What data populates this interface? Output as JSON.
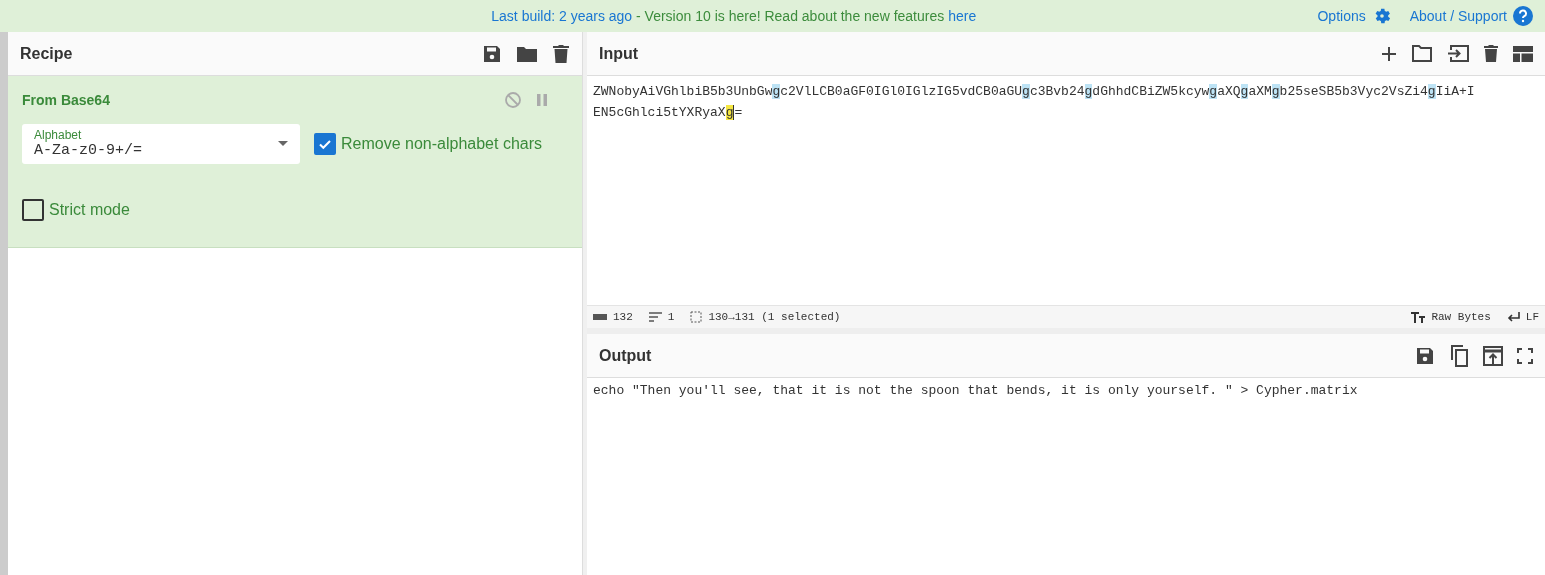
{
  "banner": {
    "segments": [
      {
        "text": "Last build: 2 years ago",
        "link": true
      },
      {
        "text": " - Version 10 is here! Read about the new features ",
        "link": false
      },
      {
        "text": "here",
        "link": true
      }
    ],
    "links": [
      {
        "label": "Options"
      },
      {
        "label": "About / Support"
      }
    ]
  },
  "recipe": {
    "title": "Recipe",
    "operations": [
      {
        "name": "From Base64",
        "alphabet": {
          "label": "Alphabet",
          "value": "A-Za-z0-9+/="
        },
        "options": [
          {
            "label": "Remove non-alphabet chars",
            "checked": true
          },
          {
            "label": "Strict mode",
            "checked": false
          }
        ]
      }
    ]
  },
  "input": {
    "title": "Input",
    "lines": [
      [
        {
          "text": "ZWNobyAiVGhlbiB5b3UnbGw",
          "match": false,
          "selected": false
        },
        {
          "text": "g",
          "match": true,
          "selected": false
        },
        {
          "text": "c2VlLCB0aGF0IGl0IGlzIG5vdCB0aGU",
          "match": false,
          "selected": false
        },
        {
          "text": "g",
          "match": true,
          "selected": false
        },
        {
          "text": "c3Bvb24",
          "match": false,
          "selected": false
        },
        {
          "text": "g",
          "match": true,
          "selected": false
        },
        {
          "text": "dGhhdCBiZW5kcyw",
          "match": false,
          "selected": false
        },
        {
          "text": "g",
          "match": true,
          "selected": false
        },
        {
          "text": "aXQ",
          "match": false,
          "selected": false
        },
        {
          "text": "g",
          "match": true,
          "selected": false
        },
        {
          "text": "aXM",
          "match": false,
          "selected": false
        },
        {
          "text": "g",
          "match": true,
          "selected": false
        },
        {
          "text": "b25seSB5b3Vyc2VsZi4",
          "match": false,
          "selected": false
        },
        {
          "text": "g",
          "match": true,
          "selected": false
        },
        {
          "text": "IiA+I",
          "match": false,
          "selected": false
        }
      ],
      [
        {
          "text": "EN5cGhlci5tYXRyaX",
          "match": false,
          "selected": false
        },
        {
          "text": "g",
          "match": false,
          "selected": true
        },
        {
          "text": "=",
          "match": false,
          "selected": false
        }
      ]
    ],
    "status": {
      "length": "132",
      "lines": "1",
      "selection": "130→131 (1 selected)",
      "encoding": "Raw Bytes",
      "eol": "LF"
    }
  },
  "output": {
    "title": "Output",
    "text": "echo \"Then you'll see, that it is not the spoon that bends, it is only yourself. \" > Cypher.matrix"
  }
}
